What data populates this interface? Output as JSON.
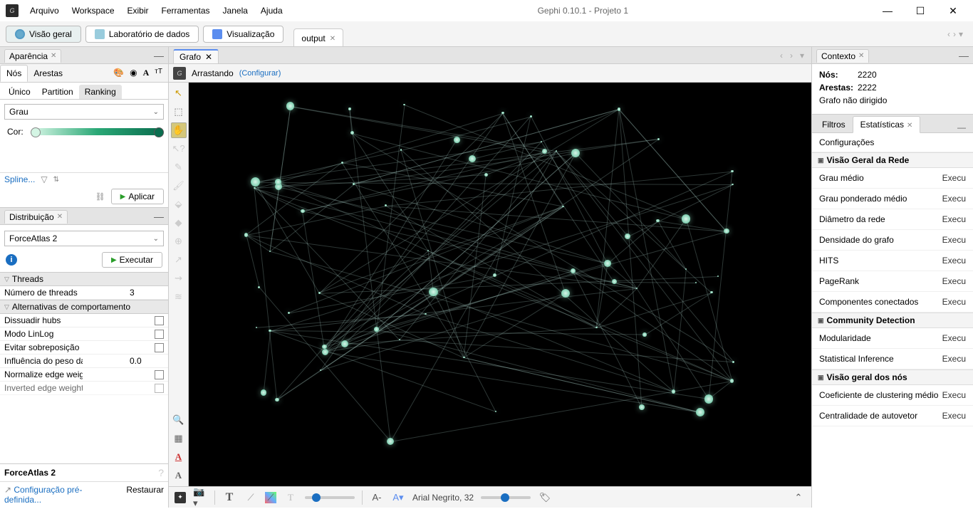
{
  "title": "Gephi 0.10.1 - Projeto 1",
  "menu": [
    "Arquivo",
    "Workspace",
    "Exibir",
    "Ferramentas",
    "Janela",
    "Ajuda"
  ],
  "ws": {
    "overview": "Visão geral",
    "datalab": "Laboratório de dados",
    "preview": "Visualização",
    "tab": "output"
  },
  "appearance": {
    "title": "Aparência",
    "nodes": "Nós",
    "edges": "Arestas",
    "unique": "Único",
    "partition": "Partition",
    "ranking": "Ranking",
    "attr": "Grau",
    "color_label": "Cor:",
    "spline": "Spline...",
    "apply": "Aplicar"
  },
  "layout": {
    "title": "Distribuição",
    "algo": "ForceAtlas 2",
    "run": "Executar",
    "g1": "Threads",
    "p_threads": "Número de threads",
    "v_threads": "3",
    "g2": "Alternativas de comportamento",
    "p_dissuade": "Dissuadir hubs",
    "p_linlog": "Modo LinLog",
    "p_overlap": "Evitar sobreposição",
    "p_weight": "Influência do peso da aresta",
    "v_weight": "0.0",
    "p_norm": "Normalize edge weights",
    "p_inv": "Inverted edge weight",
    "name": "ForceAtlas 2",
    "preset": "Configuração pré-definida...",
    "reset": "Restaurar"
  },
  "graph": {
    "title": "Grafo",
    "mode": "Arrastando",
    "config": "(Configurar)",
    "font": "Arial Negrito, 32"
  },
  "context": {
    "title": "Contexto",
    "k_nodes": "Nós:",
    "v_nodes": "2220",
    "k_edges": "Arestas:",
    "v_edges": "2222",
    "type": "Grafo não dirigido"
  },
  "stats": {
    "t_filters": "Filtros",
    "t_stats": "Estatísticas",
    "config": "Configurações",
    "g_overview": "Visão Geral da Rede",
    "g_community": "Community Detection",
    "g_nodeoverview": "Visão geral dos nós",
    "run": "Executar",
    "items1": [
      "Grau médio",
      "Grau ponderado médio",
      "Diâmetro da rede",
      "Densidade do grafo",
      "HITS",
      "PageRank",
      "Componentes conectados"
    ],
    "items2": [
      "Modularidade",
      "Statistical Inference"
    ],
    "items3": [
      "Coeficiente de clustering médio",
      "Centralidade de autovetor"
    ]
  }
}
